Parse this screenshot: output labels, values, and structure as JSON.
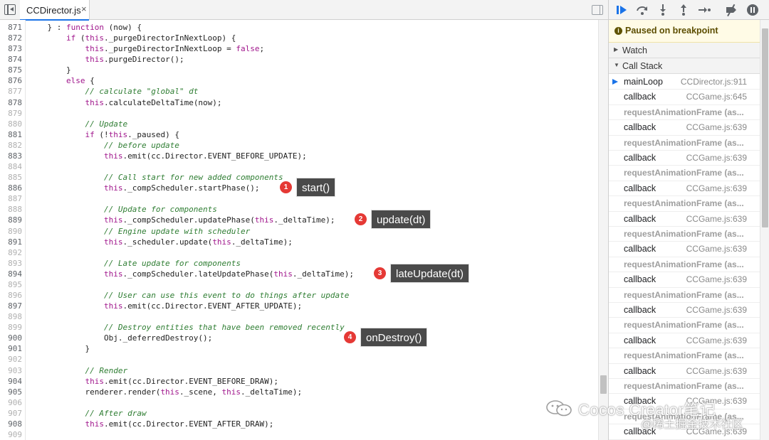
{
  "editor": {
    "tab_label": "CCDirector.js",
    "tab_close": "×",
    "lines": [
      {
        "n": "871",
        "dim": false,
        "segs": [
          {
            "t": "    } : "
          },
          {
            "t": "function",
            "c": "kw"
          },
          {
            "t": " (now) {"
          }
        ]
      },
      {
        "n": "872",
        "dim": false,
        "segs": [
          {
            "t": "        "
          },
          {
            "t": "if",
            "c": "kw"
          },
          {
            "t": " ("
          },
          {
            "t": "this",
            "c": "kw"
          },
          {
            "t": "._purgeDirectorInNextLoop) {"
          }
        ]
      },
      {
        "n": "873",
        "dim": false,
        "segs": [
          {
            "t": "            "
          },
          {
            "t": "this",
            "c": "kw"
          },
          {
            "t": "._purgeDirectorInNextLoop = "
          },
          {
            "t": "false",
            "c": "kw"
          },
          {
            "t": ";"
          }
        ]
      },
      {
        "n": "874",
        "dim": false,
        "segs": [
          {
            "t": "            "
          },
          {
            "t": "this",
            "c": "kw"
          },
          {
            "t": ".purgeDirector();"
          }
        ]
      },
      {
        "n": "875",
        "dim": false,
        "segs": [
          {
            "t": "        }"
          }
        ]
      },
      {
        "n": "876",
        "dim": false,
        "segs": [
          {
            "t": "        "
          },
          {
            "t": "else",
            "c": "kw"
          },
          {
            "t": " {"
          }
        ]
      },
      {
        "n": "877",
        "dim": true,
        "segs": [
          {
            "t": "            "
          },
          {
            "t": "// calculate \"global\" dt",
            "c": "cm"
          }
        ]
      },
      {
        "n": "878",
        "dim": false,
        "segs": [
          {
            "t": "            "
          },
          {
            "t": "this",
            "c": "kw"
          },
          {
            "t": ".calculateDeltaTime(now);"
          }
        ]
      },
      {
        "n": "879",
        "dim": true,
        "segs": []
      },
      {
        "n": "880",
        "dim": true,
        "segs": [
          {
            "t": "            "
          },
          {
            "t": "// Update",
            "c": "cm"
          }
        ]
      },
      {
        "n": "881",
        "dim": false,
        "segs": [
          {
            "t": "            "
          },
          {
            "t": "if",
            "c": "kw"
          },
          {
            "t": " (!"
          },
          {
            "t": "this",
            "c": "kw"
          },
          {
            "t": "._paused) {"
          }
        ]
      },
      {
        "n": "882",
        "dim": true,
        "segs": [
          {
            "t": "                "
          },
          {
            "t": "// before update",
            "c": "cm"
          }
        ]
      },
      {
        "n": "883",
        "dim": false,
        "segs": [
          {
            "t": "                "
          },
          {
            "t": "this",
            "c": "kw"
          },
          {
            "t": ".emit(cc.Director.EVENT_BEFORE_UPDATE);"
          }
        ]
      },
      {
        "n": "884",
        "dim": true,
        "segs": []
      },
      {
        "n": "885",
        "dim": true,
        "segs": [
          {
            "t": "                "
          },
          {
            "t": "// Call start for new added components",
            "c": "cm"
          }
        ]
      },
      {
        "n": "886",
        "dim": false,
        "segs": [
          {
            "t": "                "
          },
          {
            "t": "this",
            "c": "kw"
          },
          {
            "t": "._compScheduler.startPhase();"
          }
        ]
      },
      {
        "n": "887",
        "dim": true,
        "segs": []
      },
      {
        "n": "888",
        "dim": true,
        "segs": [
          {
            "t": "                "
          },
          {
            "t": "// Update for components",
            "c": "cm"
          }
        ]
      },
      {
        "n": "889",
        "dim": false,
        "segs": [
          {
            "t": "                "
          },
          {
            "t": "this",
            "c": "kw"
          },
          {
            "t": "._compScheduler.updatePhase("
          },
          {
            "t": "this",
            "c": "kw"
          },
          {
            "t": "._deltaTime);"
          }
        ]
      },
      {
        "n": "890",
        "dim": true,
        "segs": [
          {
            "t": "                "
          },
          {
            "t": "// Engine update with scheduler",
            "c": "cm"
          }
        ]
      },
      {
        "n": "891",
        "dim": false,
        "segs": [
          {
            "t": "                "
          },
          {
            "t": "this",
            "c": "kw"
          },
          {
            "t": "._scheduler.update("
          },
          {
            "t": "this",
            "c": "kw"
          },
          {
            "t": "._deltaTime);"
          }
        ]
      },
      {
        "n": "892",
        "dim": true,
        "segs": []
      },
      {
        "n": "893",
        "dim": true,
        "segs": [
          {
            "t": "                "
          },
          {
            "t": "// Late update for components",
            "c": "cm"
          }
        ]
      },
      {
        "n": "894",
        "dim": false,
        "segs": [
          {
            "t": "                "
          },
          {
            "t": "this",
            "c": "kw"
          },
          {
            "t": "._compScheduler.lateUpdatePhase("
          },
          {
            "t": "this",
            "c": "kw"
          },
          {
            "t": "._deltaTime);"
          }
        ]
      },
      {
        "n": "895",
        "dim": true,
        "segs": []
      },
      {
        "n": "896",
        "dim": true,
        "segs": [
          {
            "t": "                "
          },
          {
            "t": "// User can use this event to do things after update",
            "c": "cm"
          }
        ]
      },
      {
        "n": "897",
        "dim": false,
        "segs": [
          {
            "t": "                "
          },
          {
            "t": "this",
            "c": "kw"
          },
          {
            "t": ".emit(cc.Director.EVENT_AFTER_UPDATE);"
          }
        ]
      },
      {
        "n": "898",
        "dim": true,
        "segs": []
      },
      {
        "n": "899",
        "dim": true,
        "segs": [
          {
            "t": "                "
          },
          {
            "t": "// Destroy entities that have been removed recently",
            "c": "cm"
          }
        ]
      },
      {
        "n": "900",
        "dim": false,
        "segs": [
          {
            "t": "                Obj._deferredDestroy();"
          }
        ]
      },
      {
        "n": "901",
        "dim": false,
        "segs": [
          {
            "t": "            }"
          }
        ]
      },
      {
        "n": "902",
        "dim": true,
        "segs": []
      },
      {
        "n": "903",
        "dim": true,
        "segs": [
          {
            "t": "            "
          },
          {
            "t": "// Render",
            "c": "cm"
          }
        ]
      },
      {
        "n": "904",
        "dim": false,
        "segs": [
          {
            "t": "            "
          },
          {
            "t": "this",
            "c": "kw"
          },
          {
            "t": ".emit(cc.Director.EVENT_BEFORE_DRAW);"
          }
        ]
      },
      {
        "n": "905",
        "dim": false,
        "segs": [
          {
            "t": "            renderer.render("
          },
          {
            "t": "this",
            "c": "kw"
          },
          {
            "t": "._scene, "
          },
          {
            "t": "this",
            "c": "kw"
          },
          {
            "t": "._deltaTime);"
          }
        ]
      },
      {
        "n": "906",
        "dim": true,
        "segs": []
      },
      {
        "n": "907",
        "dim": true,
        "segs": [
          {
            "t": "            "
          },
          {
            "t": "// After draw",
            "c": "cm"
          }
        ]
      },
      {
        "n": "908",
        "dim": false,
        "segs": [
          {
            "t": "            "
          },
          {
            "t": "this",
            "c": "kw"
          },
          {
            "t": ".emit(cc.Director.EVENT_AFTER_DRAW);"
          }
        ]
      },
      {
        "n": "909",
        "dim": true,
        "segs": []
      }
    ]
  },
  "annotations": [
    {
      "num": "1",
      "label": "start()"
    },
    {
      "num": "2",
      "label": "update(dt)"
    },
    {
      "num": "3",
      "label": "lateUpdate(dt)"
    },
    {
      "num": "4",
      "label": "onDestroy()"
    }
  ],
  "debugger": {
    "paused_text": "Paused on breakpoint",
    "watch_label": "Watch",
    "callstack_label": "Call Stack",
    "frames": [
      {
        "fn": "mainLoop",
        "loc": "CCDirector.js:911",
        "current": true
      },
      {
        "fn": "callback",
        "loc": "CCGame.js:645"
      },
      {
        "fn": "requestAnimationFrame (as...",
        "loc": "",
        "async": true
      },
      {
        "fn": "callback",
        "loc": "CCGame.js:639"
      },
      {
        "fn": "requestAnimationFrame (as...",
        "loc": "",
        "async": true
      },
      {
        "fn": "callback",
        "loc": "CCGame.js:639"
      },
      {
        "fn": "requestAnimationFrame (as...",
        "loc": "",
        "async": true
      },
      {
        "fn": "callback",
        "loc": "CCGame.js:639"
      },
      {
        "fn": "requestAnimationFrame (as...",
        "loc": "",
        "async": true
      },
      {
        "fn": "callback",
        "loc": "CCGame.js:639"
      },
      {
        "fn": "requestAnimationFrame (as...",
        "loc": "",
        "async": true
      },
      {
        "fn": "callback",
        "loc": "CCGame.js:639"
      },
      {
        "fn": "requestAnimationFrame (as...",
        "loc": "",
        "async": true
      },
      {
        "fn": "callback",
        "loc": "CCGame.js:639"
      },
      {
        "fn": "requestAnimationFrame (as...",
        "loc": "",
        "async": true
      },
      {
        "fn": "callback",
        "loc": "CCGame.js:639"
      },
      {
        "fn": "requestAnimationFrame (as...",
        "loc": "",
        "async": true
      },
      {
        "fn": "callback",
        "loc": "CCGame.js:639"
      },
      {
        "fn": "requestAnimationFrame (as...",
        "loc": "",
        "async": true
      },
      {
        "fn": "callback",
        "loc": "CCGame.js:639"
      },
      {
        "fn": "requestAnimationFrame (as...",
        "loc": "",
        "async": true
      },
      {
        "fn": "callback",
        "loc": "CCGame.js:639"
      },
      {
        "fn": "requestAnimationFrame (as...",
        "loc": "",
        "async": true
      },
      {
        "fn": "callback",
        "loc": "CCGame.js:639"
      }
    ]
  },
  "toolbar_icons": [
    "resume-icon",
    "step-over-icon",
    "step-into-icon",
    "step-out-icon",
    "step-icon",
    "deactivate-breakpoints-icon",
    "pause-on-exceptions-icon"
  ],
  "watermark": {
    "title": "Cocos Creator笔记",
    "subtitle": "@稀土掘金技术社区"
  },
  "colors": {
    "accent": "#1a73e8",
    "keyword": "#a0168c",
    "comment": "#2e7d32",
    "marker": "#e53935",
    "paused_bg": "#fffbe6"
  }
}
